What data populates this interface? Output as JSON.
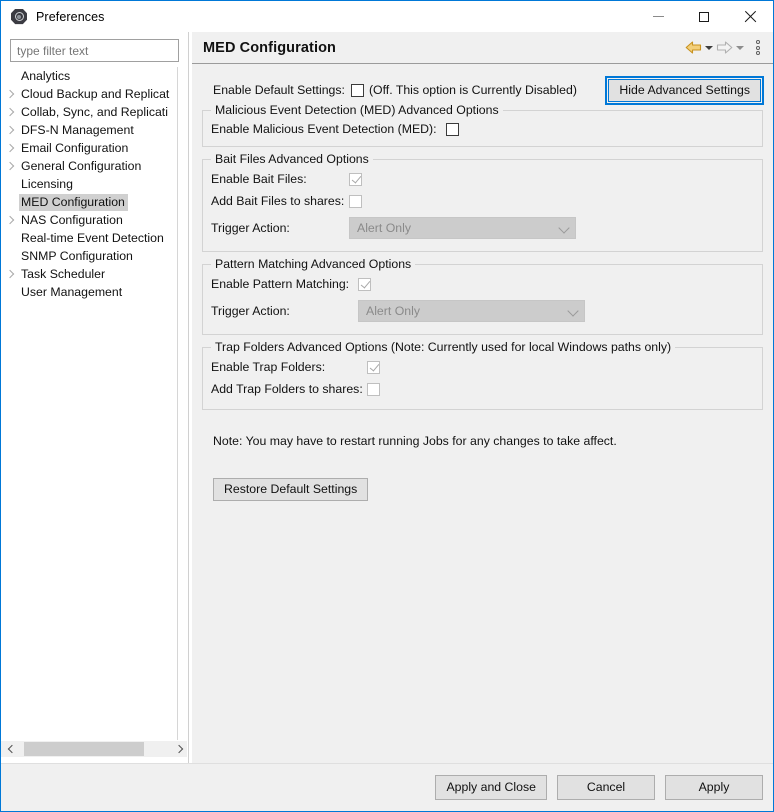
{
  "window": {
    "title": "Preferences",
    "icon": "preferences-app-icon",
    "controls": {
      "minimize": "minimize-icon",
      "maximize": "maximize-icon",
      "close": "close-icon"
    }
  },
  "colors": {
    "window_border": "#0078d7",
    "panel_bg": "#f0f0f0",
    "focus_ring": "#0078d7",
    "back_arrow": "#d9a22e",
    "forward_arrow": "#b4b4b4",
    "selection": "#d0d0d0"
  },
  "sidebar": {
    "filter": {
      "value": "",
      "placeholder": "type filter text"
    },
    "items": [
      {
        "label": "Analytics",
        "expandable": false,
        "selected": false
      },
      {
        "label": "Cloud Backup and Replicat",
        "expandable": true,
        "selected": false
      },
      {
        "label": "Collab, Sync, and Replicati",
        "expandable": true,
        "selected": false
      },
      {
        "label": "DFS-N Management",
        "expandable": true,
        "selected": false
      },
      {
        "label": "Email Configuration",
        "expandable": true,
        "selected": false
      },
      {
        "label": "General Configuration",
        "expandable": true,
        "selected": false
      },
      {
        "label": "Licensing",
        "expandable": false,
        "selected": false
      },
      {
        "label": "MED Configuration",
        "expandable": false,
        "selected": true
      },
      {
        "label": "NAS Configuration",
        "expandable": true,
        "selected": false
      },
      {
        "label": "Real-time Event Detection",
        "expandable": false,
        "selected": false
      },
      {
        "label": "SNMP Configuration",
        "expandable": false,
        "selected": false
      },
      {
        "label": "Task Scheduler",
        "expandable": true,
        "selected": false
      },
      {
        "label": "User Management",
        "expandable": false,
        "selected": false
      }
    ],
    "hscroll": {
      "left_arrow": "chevron-left-icon",
      "right_arrow": "chevron-right-icon"
    }
  },
  "page": {
    "title": "MED Configuration",
    "toolbar": {
      "back": "back-arrow-icon",
      "back_menu": "chevron-down-icon",
      "forward": "forward-arrow-icon",
      "forward_menu": "chevron-down-icon",
      "view_menu": "view-menu-icon"
    },
    "top_row": {
      "label": "Enable Default Settings:",
      "checkbox_checked": false,
      "checkbox_enabled": true,
      "status_text": "(Off. This option is Currently Disabled)",
      "advanced_button": "Hide Advanced Settings"
    },
    "groups": [
      {
        "title": "Malicious Event Detection (MED) Advanced Options",
        "rows": [
          {
            "type": "checkbox",
            "label": "Enable Malicious Event Detection (MED):",
            "checked": false,
            "enabled": true
          }
        ]
      },
      {
        "title": "Bait Files Advanced Options",
        "rows": [
          {
            "type": "checkbox",
            "label": "Enable Bait Files:",
            "checked": true,
            "enabled": false
          },
          {
            "type": "checkbox",
            "label": "Add Bait Files to shares:",
            "checked": false,
            "enabled": false
          },
          {
            "type": "combo",
            "label": "Trigger Action:",
            "value": "Alert Only",
            "enabled": false
          }
        ]
      },
      {
        "title": "Pattern Matching Advanced Options",
        "rows": [
          {
            "type": "checkbox",
            "label": "Enable Pattern Matching:",
            "checked": true,
            "enabled": false
          },
          {
            "type": "combo",
            "label": "Trigger Action:",
            "value": "Alert Only",
            "enabled": false
          }
        ]
      },
      {
        "title": "Trap Folders Advanced Options (Note: Currently used for local Windows paths only)",
        "rows": [
          {
            "type": "checkbox",
            "label": "Enable Trap Folders:",
            "checked": true,
            "enabled": false
          },
          {
            "type": "checkbox",
            "label": "Add Trap Folders to shares:",
            "checked": false,
            "enabled": false
          }
        ]
      }
    ],
    "note": "Note: You may have to restart running Jobs for any changes to take affect.",
    "restore_button": "Restore Default Settings"
  },
  "footer": {
    "apply_and_close": "Apply and Close",
    "cancel": "Cancel",
    "apply": "Apply"
  }
}
